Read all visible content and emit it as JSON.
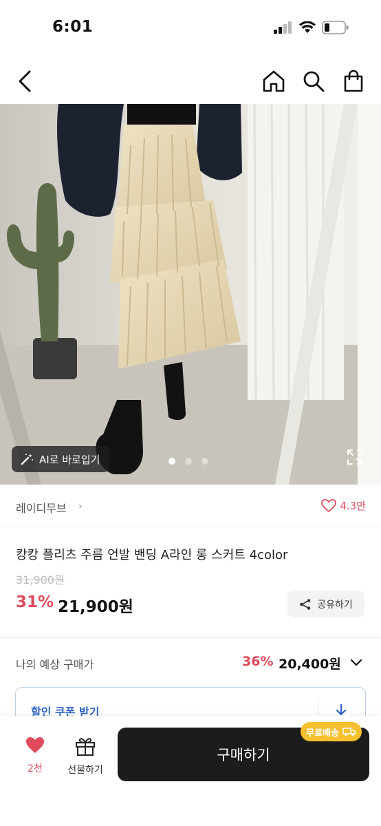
{
  "status": {
    "time": "6:01"
  },
  "product": {
    "ai_button": "AI로 바로입기",
    "image_count": 3,
    "image_index": 1,
    "brand": "레이디무브",
    "likes": "4.3만",
    "title": "캉캉 플리츠 주름 언발 밴딩 A라인 롱 스커트 4color",
    "original_price": "31,900원",
    "discount_rate": "31%",
    "sale_price": "21,900원",
    "share_label": "공유하기"
  },
  "expected": {
    "label": "나의 예상 구매가",
    "rate": "36%",
    "price": "20,400원"
  },
  "coupon": {
    "label": "할인 쿠폰 받기"
  },
  "bottom": {
    "like_count": "2천",
    "gift_label": "선물하기",
    "buy_label": "구매하기",
    "free_shipping": "무료배송"
  },
  "colors": {
    "accent_red": "#e04a5c",
    "coupon_blue": "#2f66c7",
    "free_ship_yellow": "#f6c02e",
    "buy_button": "#1c1c1c"
  }
}
